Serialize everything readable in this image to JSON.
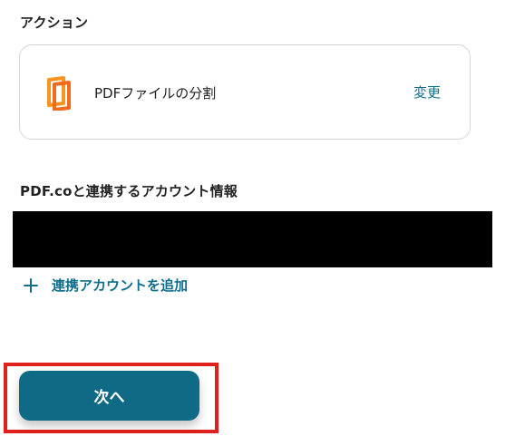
{
  "action_section": {
    "heading": "アクション",
    "card": {
      "icon": "pdfco-document-icon",
      "action_name": "PDFファイルの分割",
      "change_label": "変更"
    }
  },
  "account_section": {
    "heading": "PDF.coと連携するアカウント情報",
    "add_account_label": "連携アカウントを追加"
  },
  "next_button_label": "次へ",
  "colors": {
    "accent": "#0e6e8c",
    "button_bg": "#0f6a85",
    "highlight": "#e0201c",
    "icon_orange": "#f7931e"
  }
}
